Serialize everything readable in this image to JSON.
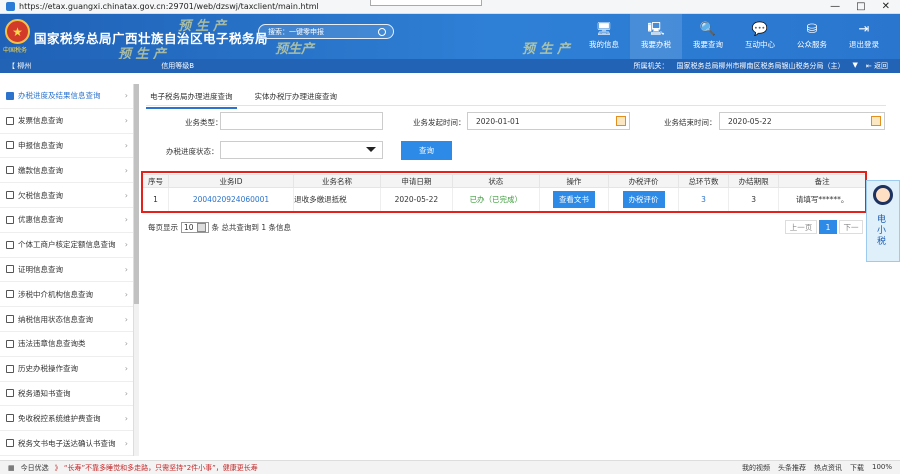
{
  "browser": {
    "url": "https://etax.guangxi.chinatax.gov.cn:29701/web/dzswj/taxclient/main.html",
    "win": [
      "—",
      "□",
      "✕"
    ]
  },
  "header": {
    "emblem_text": "中国税务",
    "title": "国家税务总局广西壮族自治区电子税务局",
    "watermarks": [
      "预 生 产",
      "预 生 产",
      "预生产",
      "预 生 产"
    ],
    "search_placeholder": "搜索：一键零申报",
    "nav": [
      {
        "label": "我的信息",
        "icon": "monitor-icon",
        "glyph": "🖥"
      },
      {
        "label": "我要办税",
        "icon": "desktop-icon",
        "glyph": "🖳"
      },
      {
        "label": "我要查询",
        "icon": "search-doc-icon",
        "glyph": "🔍"
      },
      {
        "label": "互动中心",
        "icon": "chat-icon",
        "glyph": "💬"
      },
      {
        "label": "公众服务",
        "icon": "layers-icon",
        "glyph": "⛁"
      },
      {
        "label": "退出登录",
        "icon": "logout-icon",
        "glyph": "⇥"
      }
    ]
  },
  "subbar": {
    "location": "【 柳州",
    "credit": "信用等级B",
    "org_label": "所属机关：",
    "org_value": "国家税务总局柳州市柳南区税务局银山税务分局（主）",
    "back": "返回"
  },
  "sidebar": [
    "办税进度及结果信息查询",
    "发票信息查询",
    "申报信息查询",
    "缴款信息查询",
    "欠税信息查询",
    "优惠信息查询",
    "个体工商户核定定额信息查询",
    "证明信息查询",
    "涉税中介机构信息查询",
    "纳税信用状态信息查询",
    "违法违章信息查询类",
    "历史办税操作查询",
    "税务通知书查询",
    "免收税控系统维护费查询",
    "税务文书电子送达确认书查询"
  ],
  "tabs": [
    "电子税务局办理进度查询",
    "实体办税厅办理进度查询"
  ],
  "form": {
    "biz_type_label": "业务类型：",
    "start_label": "业务发起时间：",
    "start_value": "2020-01-01",
    "end_label": "业务结束时间：",
    "end_value": "2020-05-22",
    "status_label": "办税进度状态：",
    "query_btn": "查询"
  },
  "table": {
    "headers": [
      "序号",
      "业务ID",
      "业务名称",
      "申请日期",
      "状态",
      "操作",
      "办税评价",
      "总环节数",
      "办结期限",
      "备注"
    ],
    "rows": [
      [
        "1",
        "2004020924060001",
        "退收多缴退抵税",
        "2020-05-22",
        "已办（已完成）",
        "查看文书",
        "办税评价",
        "3",
        "3",
        "请填写******。"
      ]
    ]
  },
  "pager": {
    "per_page": "每页显示",
    "per_value": "10",
    "summary": "条  总共查询到 1 条信息",
    "prev": "上一页",
    "cur": "1",
    "next": "下一"
  },
  "robot": {
    "text": "电小税"
  },
  "status": {
    "left1": "今日优选",
    "left2": "》 “长寿”不靠多睡觉和多走路，只需坚持“2件小事”，健康更长寿",
    "right": [
      "我的视频",
      "头条推荐",
      "热点资讯",
      "下载",
      "100%"
    ]
  }
}
